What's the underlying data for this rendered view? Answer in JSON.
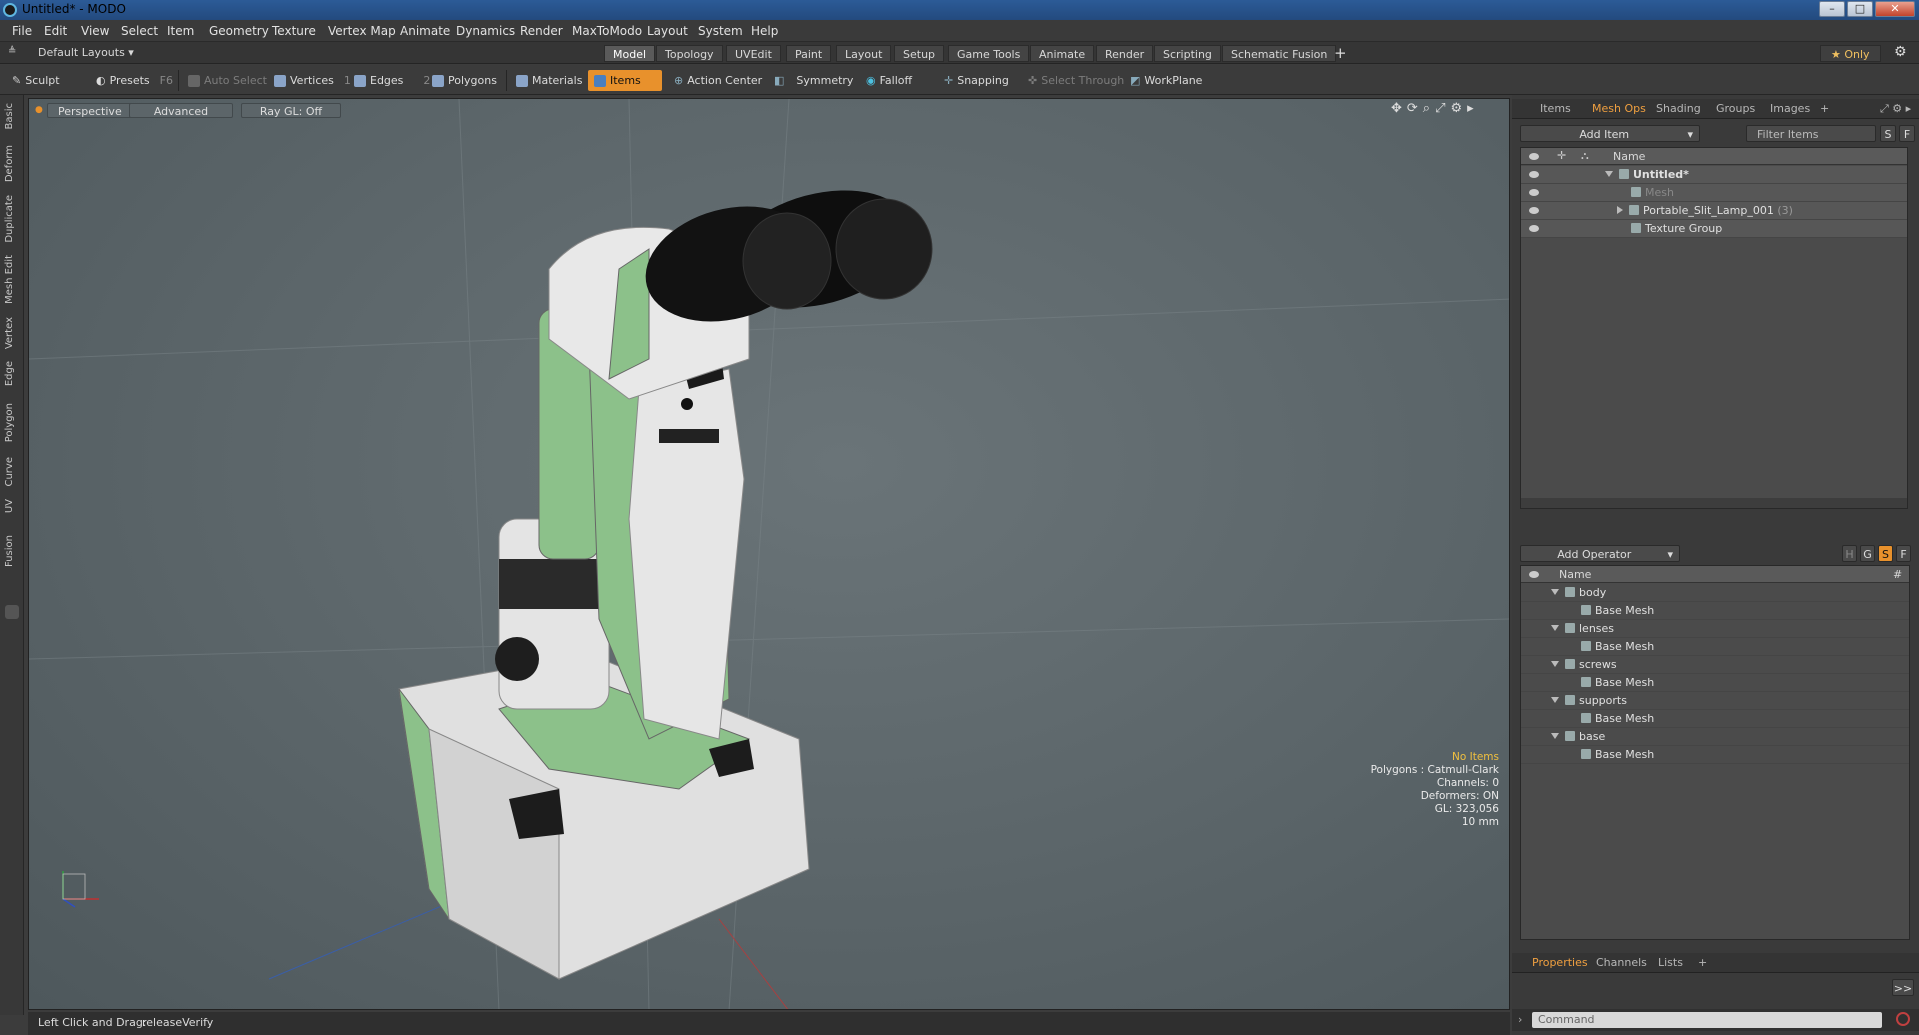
{
  "window": {
    "title": "Untitled* - MODO"
  },
  "menu": [
    "File",
    "Edit",
    "View",
    "Select",
    "Item",
    "Geometry",
    "Texture",
    "Vertex Map",
    "Animate",
    "Dynamics",
    "Render",
    "MaxToModo",
    "Layout",
    "System",
    "Help"
  ],
  "layoutbar": {
    "default_layouts": "Default Layouts ▾",
    "tabs": [
      "Model",
      "Topology",
      "UVEdit",
      "Paint",
      "Layout",
      "Setup",
      "Game Tools",
      "Animate",
      "Render",
      "Scripting",
      "Schematic Fusion"
    ],
    "active_tab": "Model",
    "only_label": "★  Only"
  },
  "toolbar": {
    "sculpt": "Sculpt",
    "presets": "Presets",
    "presets_key": "F6",
    "auto_select": "Auto Select",
    "vertices": "Vertices",
    "vertices_count": "1",
    "edges": "Edges",
    "edges_count": "2",
    "polygons": "Polygons",
    "materials": "Materials",
    "items": "Items",
    "action_center": "Action Center",
    "symmetry": "Symmetry",
    "falloff": "Falloff",
    "snapping": "Snapping",
    "select_through": "Select Through",
    "workplane": "WorkPlane"
  },
  "lefttabs": [
    "Basic",
    "Deform",
    "Duplicate",
    "Mesh Edit",
    "Vertex",
    "Edge",
    "Polygon",
    "Curve",
    "UV",
    "Fusion"
  ],
  "viewport": {
    "perspective": "Perspective",
    "advanced": "Advanced",
    "raygl": "Ray GL: Off",
    "info": {
      "no_items": "No Items",
      "polygons": "Polygons : Catmull-Clark",
      "channels": "Channels: 0",
      "deformers": "Deformers: ON",
      "gl": "GL: 323,056",
      "unit": "10 mm"
    }
  },
  "status": {
    "hint": "Left Click and Drag:",
    "action": "releaseVerify"
  },
  "items_panel": {
    "tabs": [
      "Items",
      "Mesh Ops",
      "Shading",
      "Groups",
      "Images"
    ],
    "active_tab": "Mesh Ops",
    "add_item": "Add Item",
    "filter_placeholder": "Filter Items",
    "s_btn": "S",
    "f_btn": "F",
    "col_name": "Name",
    "rows": [
      {
        "label": "Untitled*"
      },
      {
        "label": "Mesh"
      },
      {
        "label": "Portable_Slit_Lamp_001",
        "count": "(3)"
      },
      {
        "label": "Texture Group"
      }
    ]
  },
  "meshops_panel": {
    "add_operator": "Add Operator",
    "h_btn": "H",
    "g_btn": "G",
    "s_btn": "S",
    "f_btn": "F",
    "col_name": "Name",
    "col_hash": "#",
    "groups": [
      {
        "name": "body",
        "child": "Base Mesh"
      },
      {
        "name": "lenses",
        "child": "Base Mesh"
      },
      {
        "name": "screws",
        "child": "Base Mesh"
      },
      {
        "name": "supports",
        "child": "Base Mesh"
      },
      {
        "name": "base",
        "child": "Base Mesh"
      }
    ]
  },
  "props_panel": {
    "tabs": [
      "Properties",
      "Channels",
      "Lists"
    ],
    "active_tab": "Properties",
    "expand_btn": ">>",
    "command_placeholder": "Command"
  },
  "colors": {
    "accent": "#e8912c",
    "viewport": "#5b6569",
    "green": "#8cc18a"
  }
}
